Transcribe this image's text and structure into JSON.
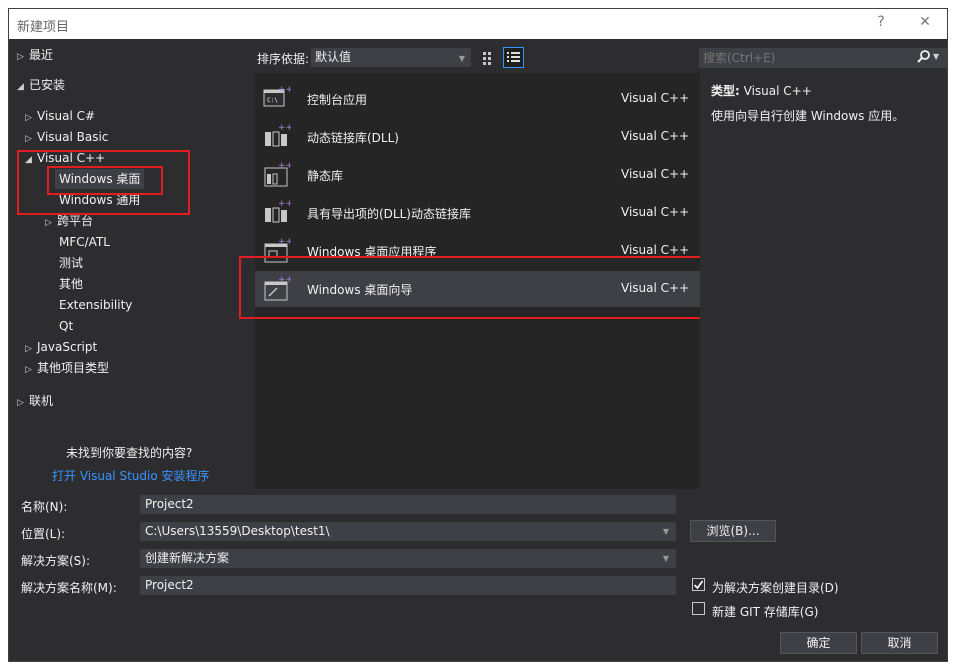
{
  "window": {
    "title": "新建项目",
    "help": "?",
    "close": "✕"
  },
  "left_tree": {
    "recent": "最近",
    "installed": "已安装",
    "visual_csharp": "Visual C#",
    "visual_basic": "Visual Basic",
    "visual_cpp": "Visual C++",
    "windows_desktop": "Windows 桌面",
    "windows_universal": "Windows 通用",
    "cross_platform": "跨平台",
    "mfc_atl": "MFC/ATL",
    "test": "测试",
    "other": "其他",
    "extensibility": "Extensibility",
    "qt": "Qt",
    "javascript": "JavaScript",
    "other_project_types": "其他项目类型",
    "online": "联机",
    "not_found": "未找到你要查找的内容?",
    "open_installer": "打开 Visual Studio 安装程序"
  },
  "toolbar": {
    "sort_label": "排序依据:",
    "sort_value": "默认值",
    "search_placeholder": "搜索(Ctrl+E)"
  },
  "templates": [
    {
      "name": "控制台应用",
      "lang": "Visual C++",
      "icon": "console-app-icon"
    },
    {
      "name": "动态链接库(DLL)",
      "lang": "Visual C++",
      "icon": "dll-icon"
    },
    {
      "name": "静态库",
      "lang": "Visual C++",
      "icon": "static-lib-icon"
    },
    {
      "name": "具有导出项的(DLL)动态链接库",
      "lang": "Visual C++",
      "icon": "dll-export-icon"
    },
    {
      "name": "Windows 桌面应用程序",
      "lang": "Visual C++",
      "icon": "desktop-app-icon"
    },
    {
      "name": "Windows 桌面向导",
      "lang": "Visual C++",
      "icon": "desktop-wizard-icon"
    }
  ],
  "details": {
    "type_label": "类型:",
    "type_value": "Visual C++",
    "description": "使用向导自行创建 Windows 应用。"
  },
  "form": {
    "name_label": "名称(N):",
    "name_value": "Project2",
    "location_label": "位置(L):",
    "location_value": "C:\\Users\\13559\\Desktop\\test1\\",
    "solution_label": "解决方案(S):",
    "solution_value": "创建新解决方案",
    "solution_name_label": "解决方案名称(M):",
    "solution_name_value": "Project2",
    "browse": "浏览(B)...",
    "create_dir": "为解决方案创建目录(D)",
    "create_git": "新建 GIT 存储库(G)",
    "ok": "确定",
    "cancel": "取消"
  },
  "colors": {
    "accent": "#3794ff",
    "highlight_box": "#e21d22",
    "background": "#2d2d30"
  }
}
